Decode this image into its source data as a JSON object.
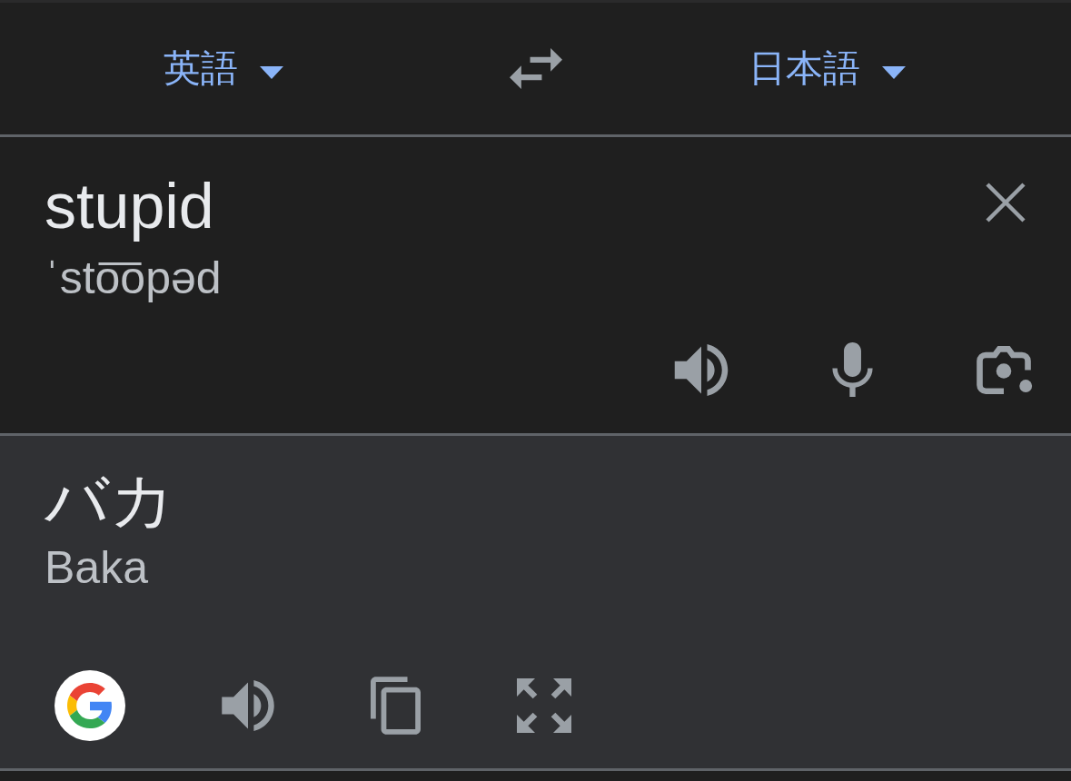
{
  "language_bar": {
    "source_language": {
      "label": "英語"
    },
    "target_language": {
      "label": "日本語"
    }
  },
  "source": {
    "text": "stupid",
    "pronunciation": "ˈsto͞opəd"
  },
  "result": {
    "text": "バカ",
    "romanization": "Baka"
  }
}
